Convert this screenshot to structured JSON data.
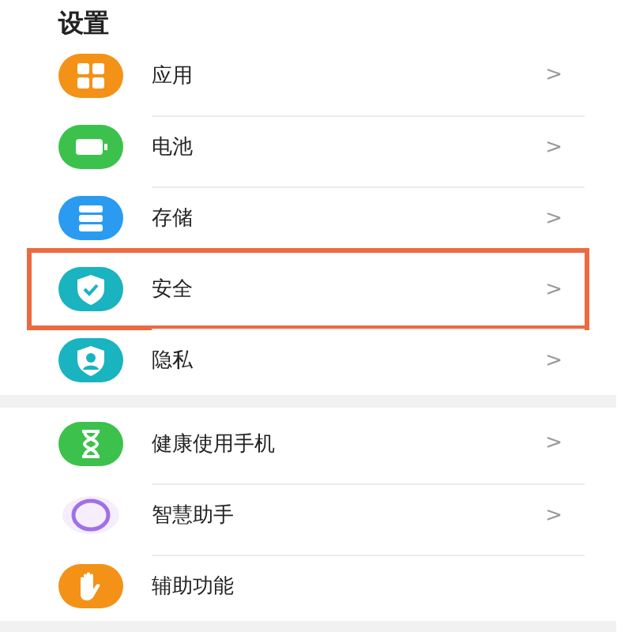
{
  "title": "设置",
  "groups": [
    {
      "items": [
        {
          "label": "应用",
          "color": "#f39217",
          "arrow": ">",
          "highlighted": false
        },
        {
          "label": "电池",
          "color": "#3cc24c",
          "arrow": ">",
          "highlighted": false
        },
        {
          "label": "存储",
          "color": "#2a9bf0",
          "arrow": ">",
          "highlighted": false
        },
        {
          "label": "安全",
          "color": "#1ab3c0",
          "arrow": ">",
          "highlighted": true
        },
        {
          "label": "隐私",
          "color": "#1ab3c0",
          "arrow": ">",
          "highlighted": false
        }
      ]
    },
    {
      "items": [
        {
          "label": "健康使用手机",
          "color": "#3cc24c",
          "arrow": ">",
          "highlighted": false
        },
        {
          "label": "智慧助手",
          "color": "#a070e8",
          "arrow": ">",
          "highlighted": false
        },
        {
          "label": "辅助功能",
          "color": "#f39217",
          "highlighted": false
        }
      ]
    }
  ]
}
